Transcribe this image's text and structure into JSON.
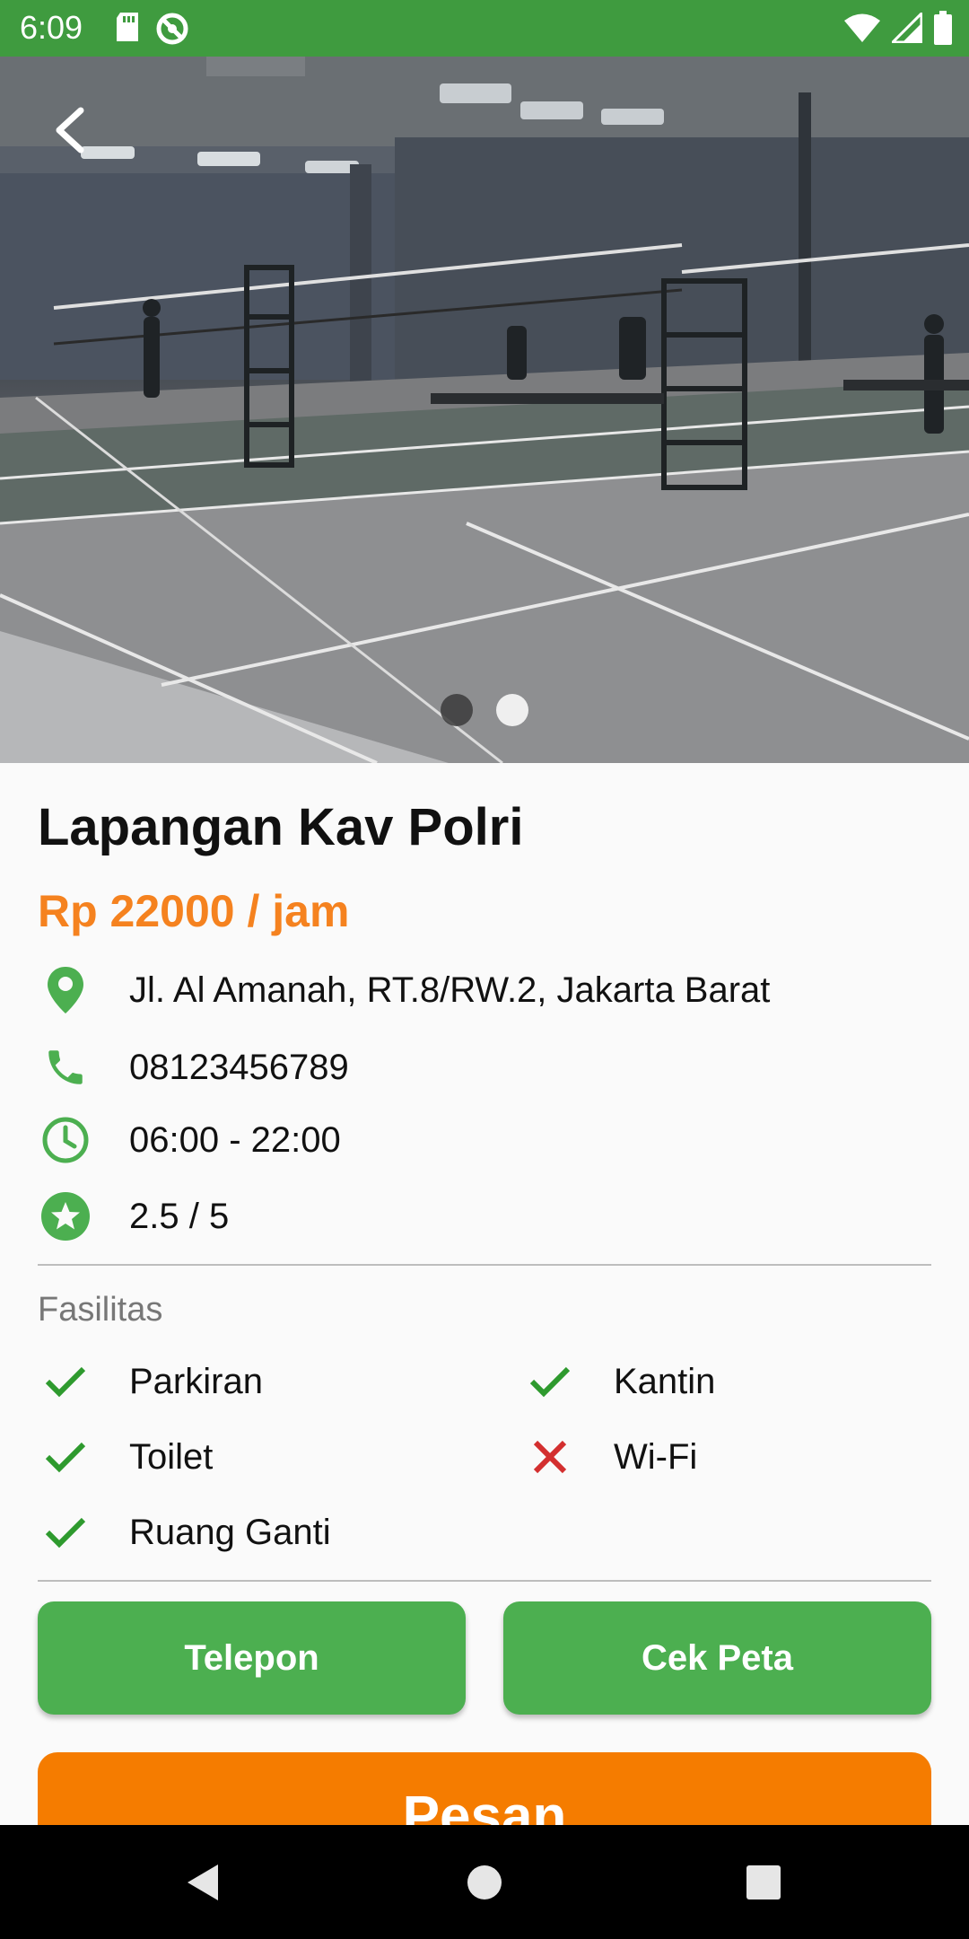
{
  "status_bar": {
    "time": "6:09",
    "left_icons": [
      "sd-card-icon",
      "sync-icon"
    ],
    "right_icons": [
      "wifi-icon",
      "signal-icon",
      "battery-icon"
    ],
    "color": "#3f9b3f"
  },
  "hero": {
    "image_description": "badminton-court-photo",
    "carousel_pages": 2,
    "active_page": 2
  },
  "venue": {
    "name": "Lapangan Kav Polri",
    "price": "Rp 22000 / jam",
    "address": "Jl. Al Amanah, RT.8/RW.2, Jakarta Barat",
    "phone": "08123456789",
    "hours": "06:00 - 22:00",
    "rating": "2.5 / 5"
  },
  "facilities": {
    "label": "Fasilitas",
    "items": [
      {
        "name": "Parkiran",
        "available": true
      },
      {
        "name": "Kantin",
        "available": true
      },
      {
        "name": "Toilet",
        "available": true
      },
      {
        "name": "Wi-Fi",
        "available": false
      },
      {
        "name": "Ruang Ganti",
        "available": true
      }
    ]
  },
  "actions": {
    "call_label": "Telepon",
    "map_label": "Cek Peta",
    "order_label": "Pesan"
  },
  "colors": {
    "primary_green": "#4caf50",
    "accent_orange": "#f57c00",
    "price_orange": "#f5821f",
    "check_green": "#2e9a2e",
    "cross_red": "#d32f2f"
  }
}
